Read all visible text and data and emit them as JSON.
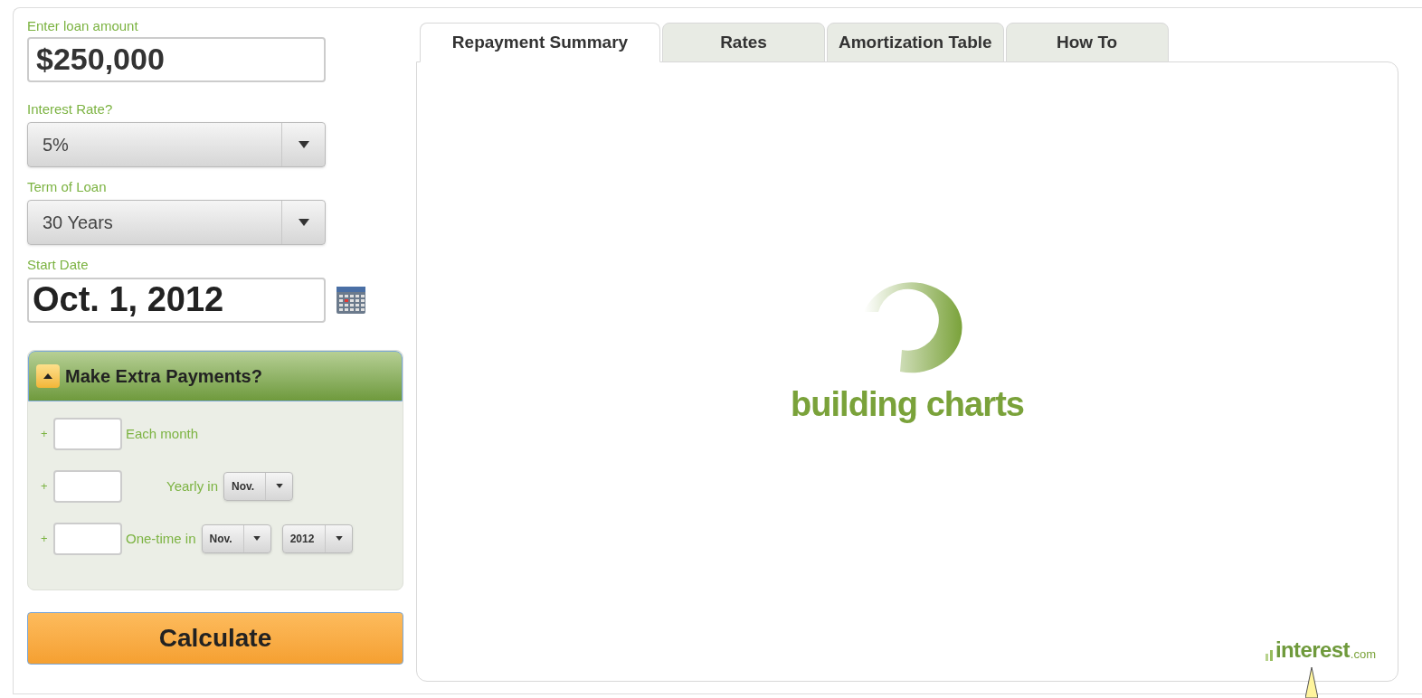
{
  "loan_amount": {
    "label": "Enter loan amount",
    "value": "$250,000"
  },
  "interest_rate": {
    "label": "Interest Rate?",
    "value": "5%"
  },
  "term": {
    "label": "Term of Loan",
    "value": "30 Years"
  },
  "start_date": {
    "label": "Start Date",
    "value": "Oct. 1, 2012"
  },
  "extra_payments": {
    "title": "Make Extra Payments?",
    "expanded": true,
    "rows": [
      {
        "prefix": "+",
        "label": "Each month",
        "selects": []
      },
      {
        "prefix": "+",
        "label": "Yearly in",
        "selects": [
          "Nov."
        ]
      },
      {
        "prefix": "+",
        "label": "One-time in",
        "selects": [
          "Nov.",
          "2012"
        ]
      }
    ]
  },
  "calculate_button": "Calculate",
  "tabs": [
    {
      "label": "Repayment Summary",
      "selected": true
    },
    {
      "label": "Rates",
      "selected": false
    },
    {
      "label": "Amortization Table",
      "selected": false
    },
    {
      "label": "How To",
      "selected": false
    }
  ],
  "loading_text": "building charts",
  "logo": {
    "name": "interest",
    "suffix": ".com"
  }
}
